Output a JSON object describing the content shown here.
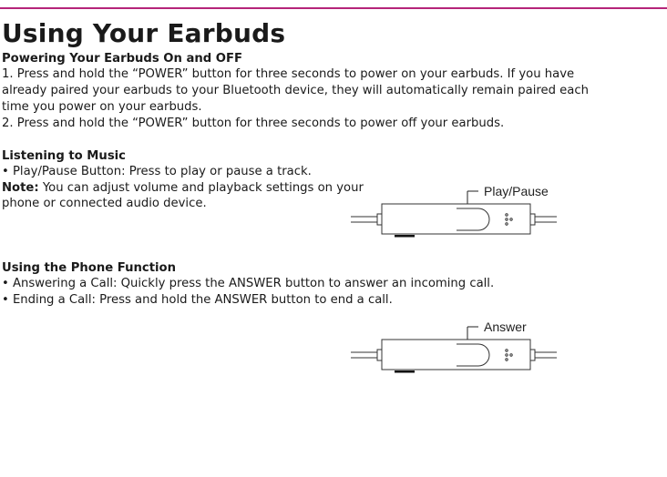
{
  "title": "Using Your Earbuds",
  "power": {
    "heading": "Powering Your Earbuds On and OFF",
    "lines": [
      "1. Press and hold the “POWER” button for three seconds to power on your earbuds. If you have",
      "already paired your earbuds to your Bluetooth device, they will automatically remain paired each",
      "time you power on your earbuds.",
      "2. Press and hold the “POWER” button for three seconds to  power off your earbuds."
    ]
  },
  "music": {
    "heading": "Listening to Music",
    "bullet": "• Play/Pause Button: Press to play or pause a track.",
    "note_label": "Note:",
    "note_text": " You can adjust volume and playback settings on your",
    "note_line2": "phone or connected audio device.",
    "diagram_label": "Play/Pause"
  },
  "phone": {
    "heading": "Using the Phone Function",
    "lines": [
      "• Answering a Call: Quickly press the ANSWER button to answer an incoming call.",
      "• Ending a Call: Press and hold the ANSWER button to end a call."
    ],
    "diagram_label": "Answer"
  }
}
